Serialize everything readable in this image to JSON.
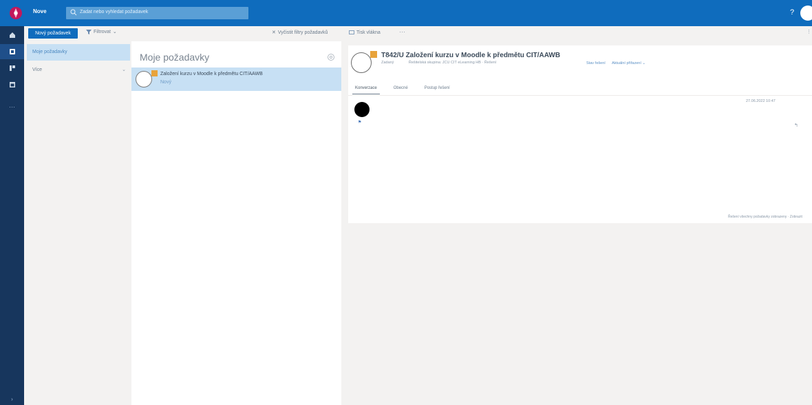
{
  "header": {
    "brand": "Nove",
    "search_placeholder": "Zadat nebo vyhledat požadavek",
    "help_label": "?",
    "accent": "#0f6cbd"
  },
  "rail": {
    "items": [
      {
        "icon": "home-icon",
        "active": false
      },
      {
        "icon": "requests-icon",
        "active": true
      },
      {
        "icon": "board-icon",
        "active": false
      },
      {
        "icon": "calendar-icon",
        "active": false
      }
    ],
    "more_label": "···",
    "bottom_label": "›"
  },
  "toolbar": {
    "new_label": "Nový požadavek",
    "filter_label": "Filtrovat",
    "clear_label": "Vyčistit filtry požadavků",
    "print_label": "Tisk vlákna",
    "dots_label": "···",
    "right_label": "⋮"
  },
  "folders": {
    "items": [
      {
        "label": "Moje požadavky",
        "selected": true
      },
      {
        "label": "Více",
        "selected": false,
        "chevron": "⌄"
      }
    ]
  },
  "list": {
    "title": "Moje požadavky",
    "items": [
      {
        "title": "Založení kurzu v Moodle k předmětu CIT/AAWB",
        "status": "Nový"
      }
    ]
  },
  "reading": {
    "title": "T842/U Založení kurzu v Moodle k předmětu CIT/AAWB",
    "meta": [
      "Zadaný",
      "Řešitelská skupina: JCU CIT eLearning HB · Řešení"
    ],
    "links": [
      "Stav řešení",
      "Aktuální přiřazení ⌄"
    ],
    "tabs": [
      {
        "label": "Konverzace",
        "active": true
      },
      {
        "label": "Obecné",
        "active": false
      },
      {
        "label": "Postup řešení",
        "active": false
      }
    ],
    "conversation": {
      "date": "27.06.2022 10:47",
      "reply_label": "↰",
      "footer": "Řešení všechny požadavky zobrazeny · Zobrazit"
    }
  }
}
